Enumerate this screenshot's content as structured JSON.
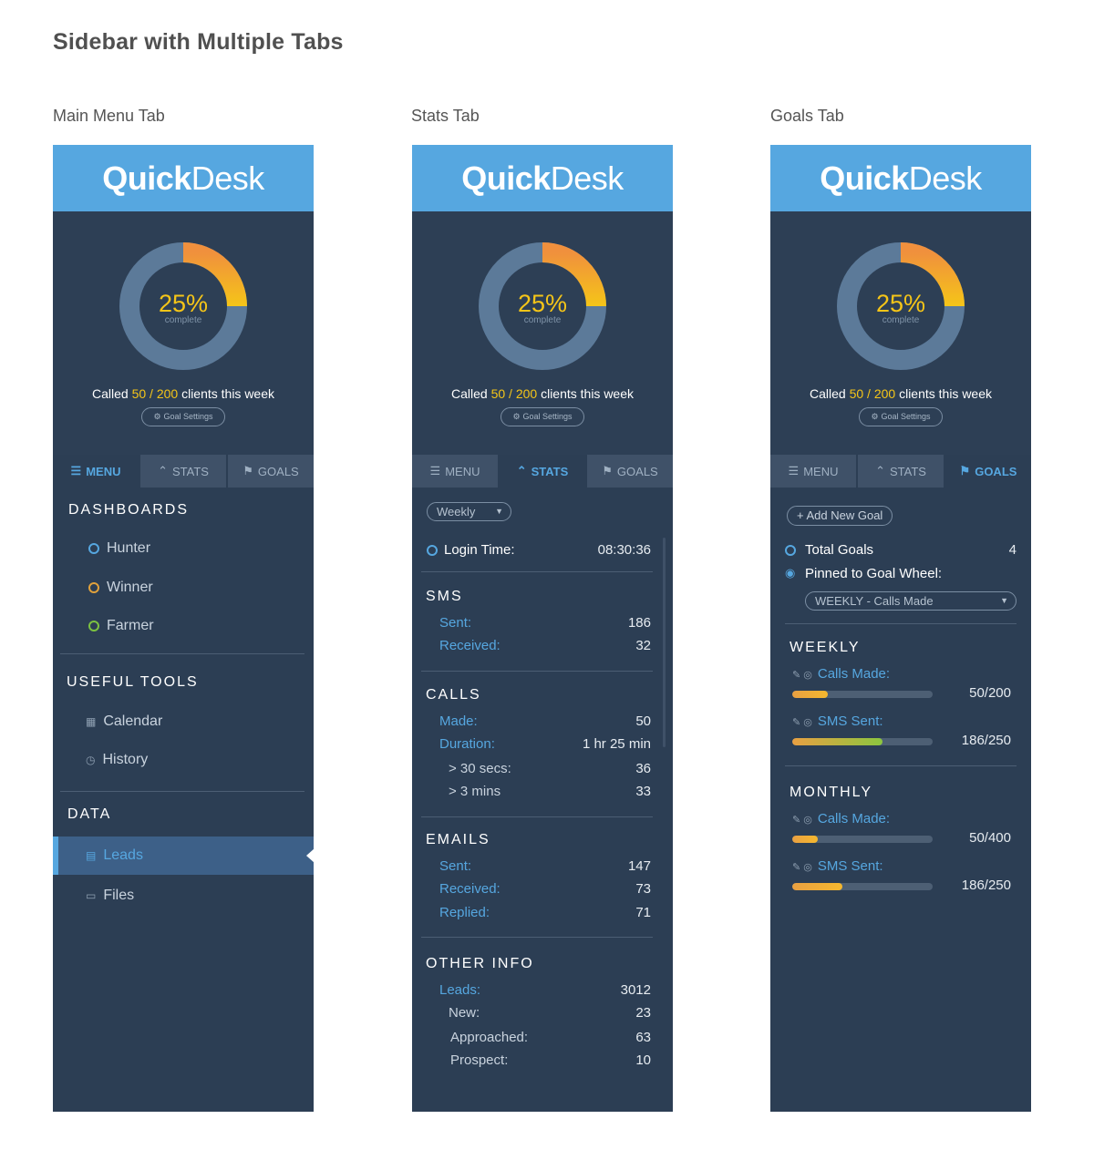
{
  "page": {
    "title": "Sidebar with Multiple Tabs"
  },
  "captions": [
    "Main Menu Tab",
    "Stats Tab",
    "Goals Tab"
  ],
  "brand": {
    "quick": "Quick",
    "desk": "Desk"
  },
  "donut": {
    "percent_label": "25%",
    "sub_label": "complete",
    "progress": 0.25,
    "track_color": "#5c7a99",
    "start_color": "#f0903d",
    "end_color": "#f5c518"
  },
  "called": {
    "prefix": "Called ",
    "done": "50",
    "sep": " / ",
    "total": "200",
    "suffix": " clients this week"
  },
  "goal_settings": {
    "label": "Goal Settings"
  },
  "tabs": {
    "menu": "MENU",
    "stats": "STATS",
    "goals": "GOALS"
  },
  "colors": {
    "accent": "#56a7e0",
    "panel": "#2c3e54",
    "highlight": "#f5c518"
  },
  "menu": {
    "dashboards_heading": "DASHBOARDS",
    "dashboards": [
      {
        "label": "Hunter",
        "dot_color": "#56a7e0"
      },
      {
        "label": "Winner",
        "dot_color": "#e0a13c"
      },
      {
        "label": "Farmer",
        "dot_color": "#7cc241"
      }
    ],
    "tools_heading": "USEFUL TOOLS",
    "tools": [
      {
        "label": "Calendar",
        "icon": "calendar-icon"
      },
      {
        "label": "History",
        "icon": "clock-icon"
      }
    ],
    "data_heading": "DATA",
    "data": [
      {
        "label": "Leads",
        "icon": "document-icon",
        "active": true
      },
      {
        "label": "Files",
        "icon": "folder-icon",
        "active": false
      }
    ]
  },
  "stats": {
    "period": "Weekly",
    "login_label": "Login Time:",
    "login_value": "08:30:36",
    "sms_heading": "SMS",
    "sms": [
      {
        "label": "Sent:",
        "value": "186"
      },
      {
        "label": "Received:",
        "value": "32"
      }
    ],
    "calls_heading": "CALLS",
    "calls": [
      {
        "label": "Made:",
        "value": "50"
      },
      {
        "label": "Duration:",
        "value": "1 hr 25 min"
      },
      {
        "label": "> 30 secs:",
        "value": "36"
      },
      {
        "label": "> 3 mins",
        "value": "33"
      }
    ],
    "emails_heading": "EMAILS",
    "emails": [
      {
        "label": "Sent:",
        "value": "147"
      },
      {
        "label": "Received:",
        "value": "73"
      },
      {
        "label": "Replied:",
        "value": "71"
      }
    ],
    "other_heading": "OTHER INFO",
    "other": [
      {
        "label": "Leads:",
        "value": "3012"
      },
      {
        "label": "New:",
        "value": "23"
      },
      {
        "label": "Approached:",
        "value": "63"
      },
      {
        "label": "Prospect:",
        "value": "10"
      }
    ]
  },
  "goals": {
    "add_label": "Add New Goal",
    "total_label": "Total Goals",
    "total_value": "4",
    "pinned_label": "Pinned to Goal Wheel:",
    "pinned_select": "WEEKLY - Calls Made",
    "weekly_heading": "WEEKLY",
    "weekly": [
      {
        "label": "Calls Made:",
        "value": "50/200",
        "fraction": 0.25,
        "fill": "#f5b82e"
      },
      {
        "label": "SMS Sent:",
        "value": "186/250",
        "fraction": 0.64,
        "fill": "#8cc63f"
      }
    ],
    "monthly_heading": "MONTHLY",
    "monthly": [
      {
        "label": "Calls Made:",
        "value": "50/400",
        "fraction": 0.18,
        "fill": "#f5b82e"
      },
      {
        "label": "SMS Sent:",
        "value": "186/250",
        "fraction": 0.36,
        "fill": "#f5b82e"
      }
    ]
  }
}
